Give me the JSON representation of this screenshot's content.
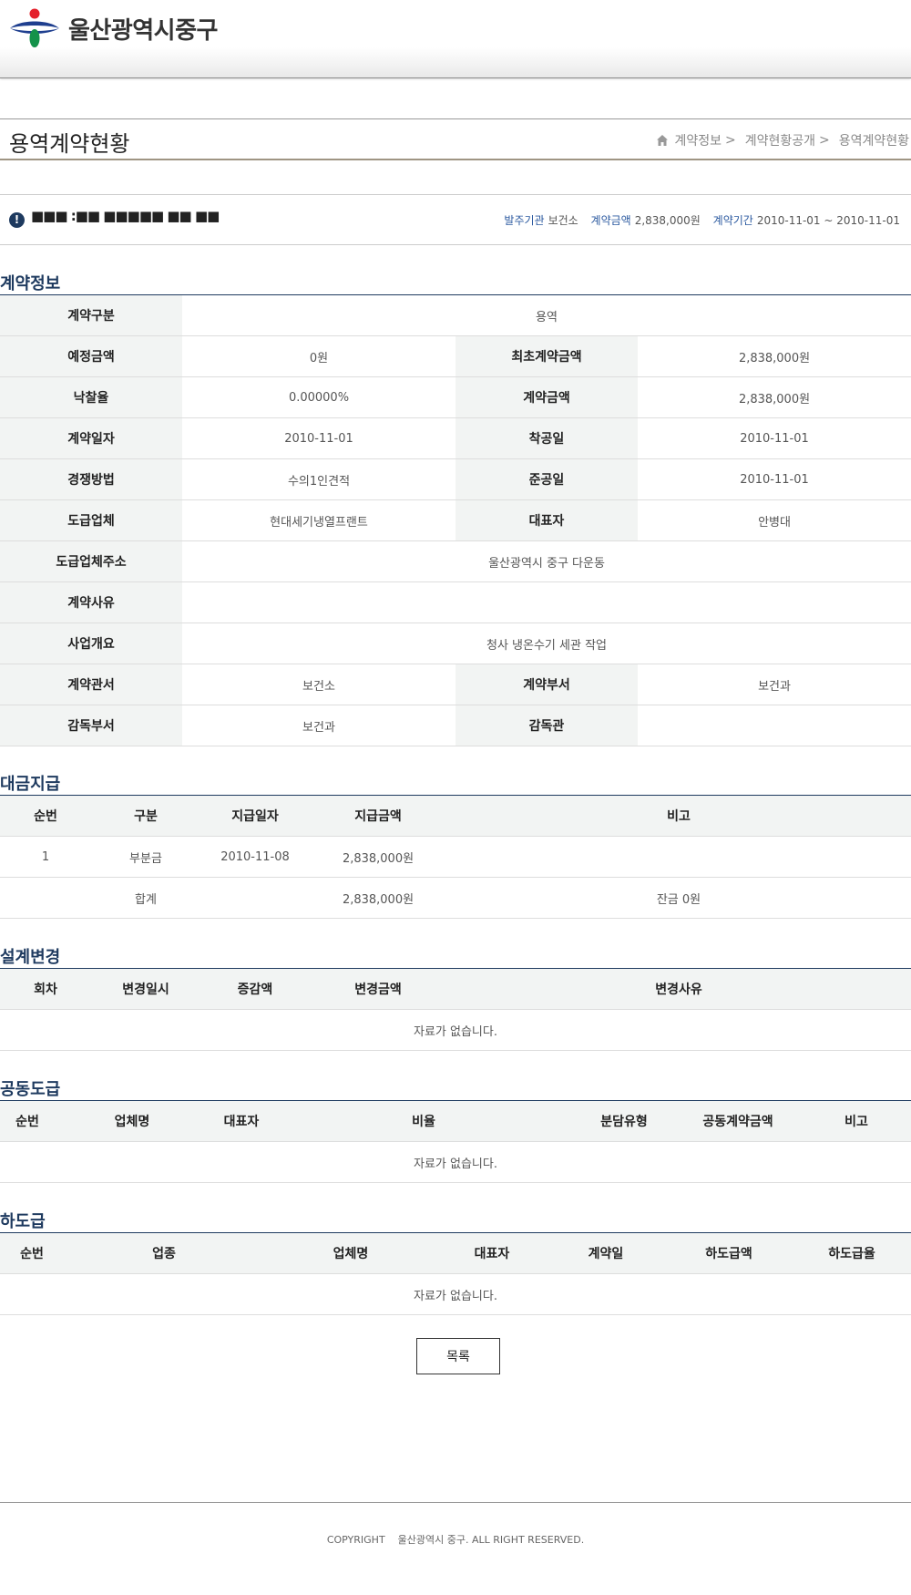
{
  "header": {
    "logo_text": "울산광역시중구",
    "brand_colors": {
      "red": "#e4202b",
      "blue": "#1f3f8f",
      "green": "#14924a"
    }
  },
  "page": {
    "title": "용역계약현황",
    "breadcrumb": [
      "계약정보",
      "계약현황공개",
      "용역계약현황"
    ],
    "breadcrumb_sep": ">"
  },
  "summary": {
    "alert_icon": "!",
    "contract_name": "■■■ :■■ ■■■■■ ■■ ■■",
    "agency_label": "발주기관",
    "agency": "보건소",
    "amount_label": "계약금액",
    "amount": "2,838,000원",
    "period_label": "계약기간",
    "period": "2010-11-01 ~ 2010-11-01"
  },
  "contract_info": {
    "title": "계약정보",
    "rows": [
      {
        "l1": "계약구분",
        "v1": "용역"
      },
      {
        "l1": "예정금액",
        "v1": "0원",
        "l2": "최초계약금액",
        "v2": "2,838,000원"
      },
      {
        "l1": "낙찰율",
        "v1": "0.00000%",
        "l2": "계약금액",
        "v2": "2,838,000원"
      },
      {
        "l1": "계약일자",
        "v1": "2010-11-01",
        "l2": "착공일",
        "v2": "2010-11-01"
      },
      {
        "l1": "경쟁방법",
        "v1": "수의1인견적",
        "l2": "준공일",
        "v2": "2010-11-01"
      },
      {
        "l1": "도급업체",
        "v1": "현대세기냉열프랜트",
        "l2": "대표자",
        "v2": "안병대"
      },
      {
        "l1": "도급업체주소",
        "v1": "울산광역시 중구 다운동"
      },
      {
        "l1": "계약사유",
        "v1": ""
      },
      {
        "l1": "사업개요",
        "v1": "청사 냉온수기 세관 작업"
      },
      {
        "l1": "계약관서",
        "v1": "보건소",
        "l2": "계약부서",
        "v2": "보건과"
      },
      {
        "l1": "감독부서",
        "v1": "보건과",
        "l2": "감독관",
        "v2": ""
      }
    ]
  },
  "payment": {
    "title": "대금지급",
    "headers": [
      "순번",
      "구분",
      "지급일자",
      "지급금액",
      "비고"
    ],
    "rows": [
      [
        "1",
        "부분금",
        "2010-11-08",
        "2,838,000원",
        ""
      ]
    ],
    "total_label": "합계",
    "total_amount": "2,838,000원",
    "total_note": "잔금 0원"
  },
  "design_change": {
    "title": "설계변경",
    "headers": [
      "회차",
      "변경일시",
      "증감액",
      "변경금액",
      "변경사유"
    ],
    "empty": "자료가 없습니다."
  },
  "joint": {
    "title": "공동도급",
    "headers": [
      "순번",
      "업체명",
      "대표자",
      "비율",
      "분담유형",
      "공동계약금액",
      "비고"
    ],
    "empty": "자료가 없습니다."
  },
  "subcontract": {
    "title": "하도급",
    "headers": [
      "순번",
      "업종",
      "업체명",
      "대표자",
      "계약일",
      "하도급액",
      "하도급율"
    ],
    "empty": "자료가 없습니다."
  },
  "list_button": "목록",
  "footer": {
    "copyright_label": "COPYRIGHT",
    "copyright_text": "울산광역시 중구. ALL RIGHT RESERVED."
  }
}
